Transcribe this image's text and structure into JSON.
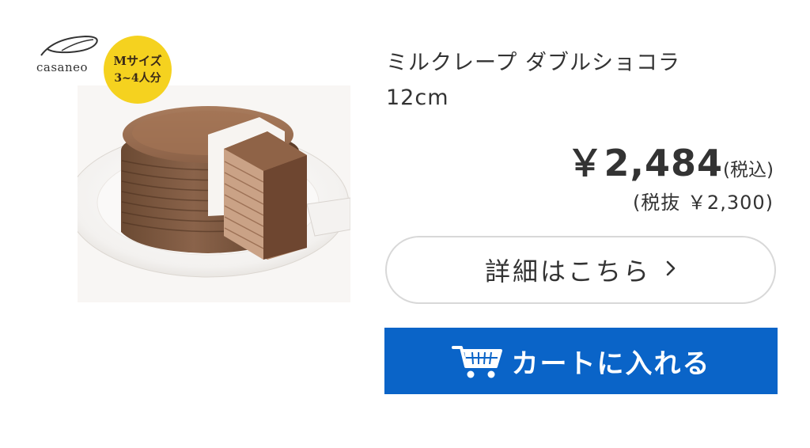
{
  "brand": {
    "name": "casaneo",
    "logo_icon": "casaneo-swoosh-logo"
  },
  "badge": {
    "size_label": "Mサイズ",
    "servings": "3~4人分",
    "color": "#f5d21f"
  },
  "product": {
    "name_line1": "ミルクレープ ダブルショコラ",
    "name_line2": "12cm",
    "image_icon": "chocolate-crepe-cake-photo"
  },
  "price": {
    "value": "￥2,484",
    "tax_included_label": "(税込)",
    "tax_excluded": "(税抜 ￥2,300)"
  },
  "actions": {
    "detail_label": "詳細はこちら",
    "detail_icon": "chevron-right-icon",
    "cart_label": "カートに入れる",
    "cart_icon": "shopping-cart-icon",
    "cart_color": "#0a64c8"
  }
}
